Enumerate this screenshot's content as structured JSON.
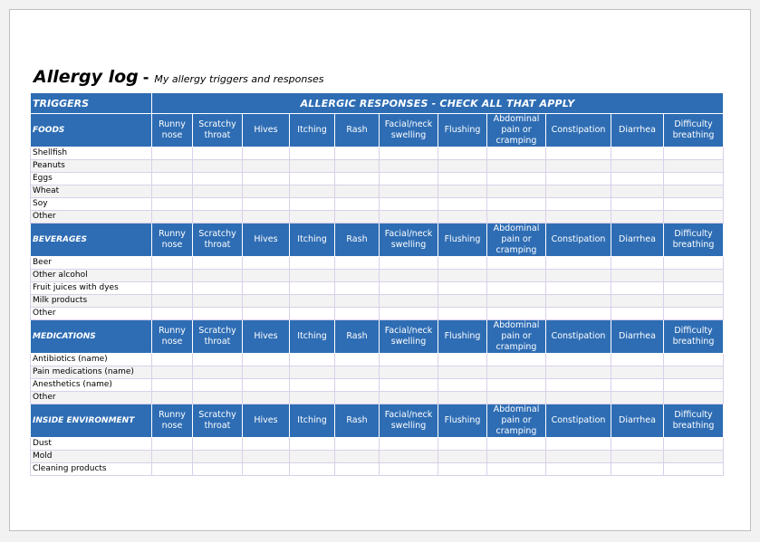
{
  "title": "Allergy log",
  "title_dash": "-",
  "subtitle": "My allergy triggers and responses",
  "triggers_header": "TRIGGERS",
  "responses_header": "ALLERGIC RESPONSES - CHECK ALL THAT APPLY",
  "responses": [
    "Runny nose",
    "Scratchy throat",
    "Hives",
    "Itching",
    "Rash",
    "Facial/neck swelling",
    "Flushing",
    "Abdominal pain or cramping",
    "Constipation",
    "Diarrhea",
    "Difficulty breathing"
  ],
  "sections": [
    {
      "category": "FOODS",
      "items": [
        "Shellfish",
        "Peanuts",
        "Eggs",
        "Wheat",
        "Soy",
        "Other"
      ]
    },
    {
      "category": "BEVERAGES",
      "items": [
        "Beer",
        "Other alcohol",
        "Fruit juices with dyes",
        "Milk products",
        "Other"
      ]
    },
    {
      "category": "MEDICATIONS",
      "items": [
        "Antibiotics (name)",
        "Pain medications (name)",
        "Anesthetics (name)",
        "Other"
      ]
    },
    {
      "category": "INSIDE ENVIRONMENT",
      "items": [
        "Dust",
        "Mold",
        "Cleaning products"
      ]
    }
  ],
  "colors": {
    "header_blue": "#2e6db4",
    "grid": "#d9d0ea",
    "alt_row": "#f3f3f3"
  }
}
